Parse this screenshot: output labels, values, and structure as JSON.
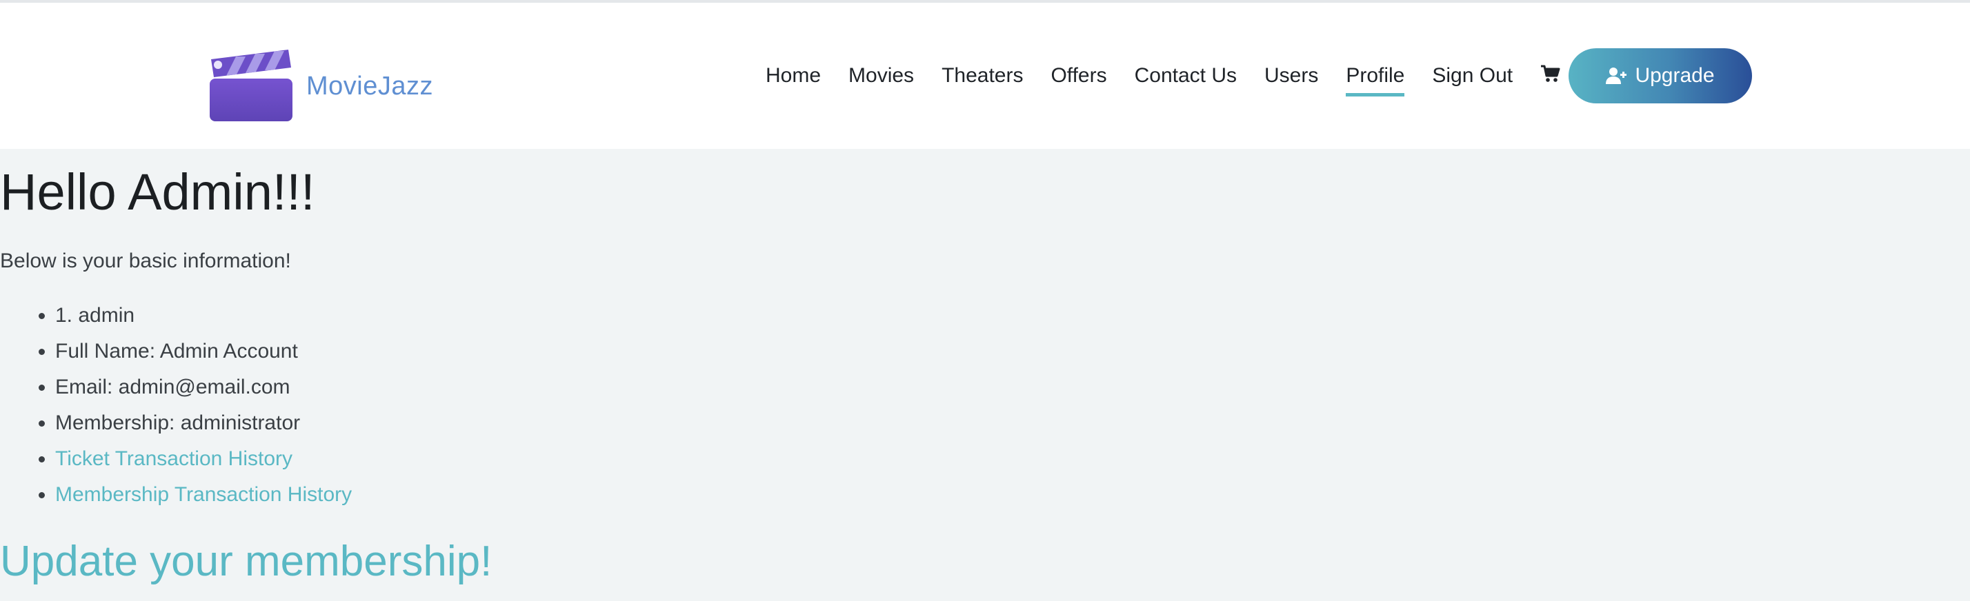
{
  "brand": {
    "name": "MovieJazz"
  },
  "nav": {
    "items": [
      {
        "label": "Home"
      },
      {
        "label": "Movies"
      },
      {
        "label": "Theaters"
      },
      {
        "label": "Offers"
      },
      {
        "label": "Contact Us"
      },
      {
        "label": "Users"
      },
      {
        "label": "Profile",
        "active": true
      },
      {
        "label": "Sign Out"
      }
    ],
    "cart_icon": "cart-icon",
    "upgrade_label": "Upgrade",
    "upgrade_icon": "user-plus-icon"
  },
  "main": {
    "greeting": "Hello Admin!!!",
    "intro": "Below is your basic information!",
    "info": [
      "1. admin",
      "Full Name: Admin Account",
      "Email: admin@email.com",
      "Membership: administrator"
    ],
    "links": [
      "Ticket Transaction History",
      "Membership Transaction History"
    ],
    "update_heading": "Update your membership!"
  },
  "colors": {
    "accent": "#5ab8c4",
    "logo_purple": "#6b4fc2",
    "background": "#f1f4f5"
  }
}
